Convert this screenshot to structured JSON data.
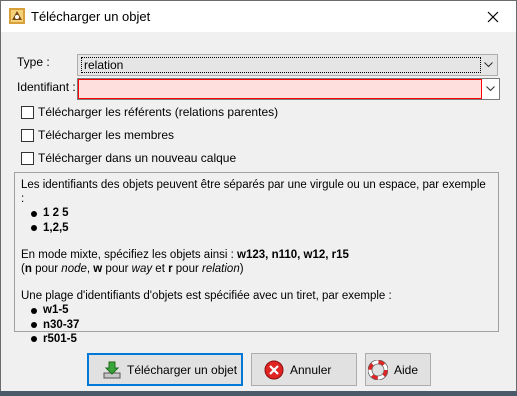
{
  "window": {
    "title": "Télécharger un objet"
  },
  "form": {
    "type_label": "Type :",
    "type_value": "relation",
    "id_label": "Identifiant :",
    "id_value": ""
  },
  "checkboxes": [
    {
      "label": "Télécharger les référents (relations parentes)",
      "checked": false
    },
    {
      "label": "Télécharger les membres",
      "checked": false
    },
    {
      "label": "Télécharger dans un nouveau calque",
      "checked": false
    }
  ],
  "info": {
    "line1": "Les identifiants des objets peuvent être séparés par une virgule ou un espace, par exemple :",
    "ex1": [
      "1 2 5",
      "1,2,5"
    ],
    "mixed_prefix": "En mode mixte, spécifiez les objets ainsi : ",
    "mixed_examples": "w123, n110, w12, r15",
    "mixed_note_parts": [
      {
        "t": "(",
        "b": false,
        "i": false
      },
      {
        "t": "n",
        "b": true,
        "i": false
      },
      {
        "t": " pour ",
        "b": false,
        "i": false
      },
      {
        "t": "node",
        "b": false,
        "i": true
      },
      {
        "t": ", ",
        "b": false,
        "i": false
      },
      {
        "t": "w",
        "b": true,
        "i": false
      },
      {
        "t": " pour ",
        "b": false,
        "i": false
      },
      {
        "t": "way",
        "b": false,
        "i": true
      },
      {
        "t": " et ",
        "b": false,
        "i": false
      },
      {
        "t": "r",
        "b": true,
        "i": false
      },
      {
        "t": " pour ",
        "b": false,
        "i": false
      },
      {
        "t": "relation",
        "b": false,
        "i": true
      },
      {
        "t": ")",
        "b": false,
        "i": false
      }
    ],
    "range_line": "Une plage d'identifiants d'objets est spécifiée avec un tiret, par exemple :",
    "ex2": [
      "w1-5",
      "n30-37",
      "r501-5"
    ]
  },
  "buttons": {
    "download": "Télécharger un objet",
    "cancel": "Annuler",
    "help": "Aide"
  },
  "icons": {
    "app": "josm-app-icon",
    "close": "close-icon",
    "download": "download-icon",
    "cancel": "cancel-icon",
    "help": "help-lifebuoy-icon"
  },
  "colors": {
    "error_field_bg": "#ffdede",
    "error_field_border": "#ff0000",
    "focus_border": "#0078d7"
  }
}
